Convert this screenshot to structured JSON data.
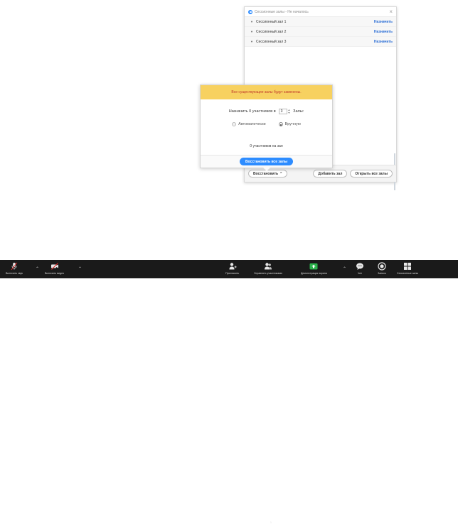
{
  "breakout_window": {
    "title": "Сессионные залы - Не началось",
    "close_glyph": "×",
    "rooms": [
      {
        "name": "Сессионный зал 1",
        "action": "Назначить"
      },
      {
        "name": "Сессионный зал 2",
        "action": "Назначить"
      },
      {
        "name": "Сессионный зал 3",
        "action": "Назначить"
      }
    ],
    "footer": {
      "recreate_label": "Восстановить",
      "add_room_label": "Добавить зал",
      "open_all_label": "Открыть все залы"
    }
  },
  "recreate_popover": {
    "warning": "Все существующие залы будут заменены.",
    "assign_prefix": "Назначить 0 участников в",
    "room_count": "3",
    "assign_suffix": "Залы:",
    "mode_auto": "Автоматически",
    "mode_manual": "Вручную",
    "selected_mode": "manual",
    "per_room": "0 участников на зал",
    "recreate_all_label": "Восстановить все залы"
  },
  "toolbar": {
    "items": [
      {
        "label": "Включить звук",
        "icon": "muted-microphone-icon"
      },
      {
        "label": "Включить видео",
        "icon": "video-off-icon"
      },
      {
        "label": "Пригласить",
        "icon": "invite-icon"
      },
      {
        "label": "Управлять участниками",
        "icon": "participants-icon"
      },
      {
        "label": "Демонстрация экрана",
        "icon": "share-screen-icon"
      },
      {
        "label": "Чат",
        "icon": "chat-icon"
      },
      {
        "label": "Запись",
        "icon": "record-icon"
      },
      {
        "label": "Сессионные залы",
        "icon": "breakout-rooms-icon"
      }
    ],
    "participant_count": "1"
  },
  "colors": {
    "accent": "#2d8cff",
    "warning_bg": "#f7d160",
    "warning_text": "#c0392b",
    "toolbar_bg": "#1a1a1a",
    "share_green": "#2bb24c"
  }
}
